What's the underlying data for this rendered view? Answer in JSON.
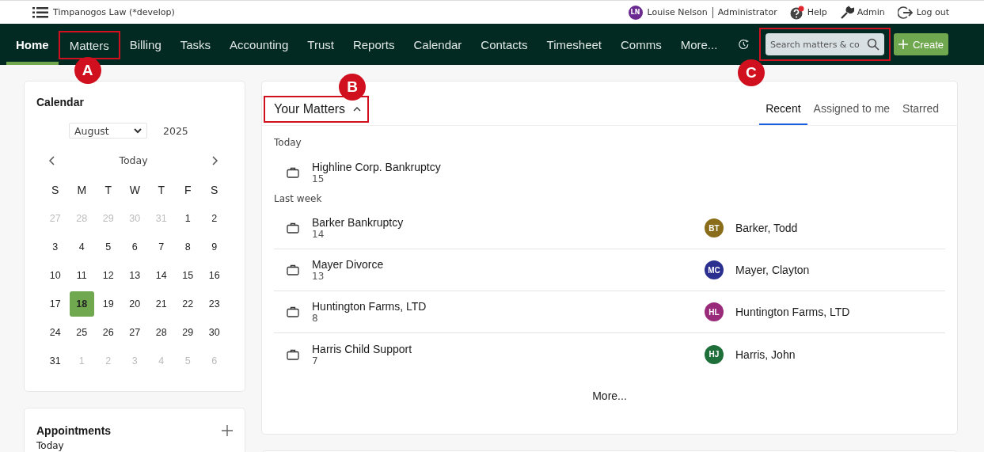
{
  "topbar": {
    "app_title": "Timpanogos Law (*develop)",
    "user": {
      "initials": "LN",
      "name": "Louise Nelson",
      "role": "Administrator",
      "color": "#6b2a8f"
    },
    "links": [
      {
        "kind": "help",
        "label": "Help",
        "notification": true
      },
      {
        "kind": "admin",
        "label": "Admin"
      },
      {
        "kind": "logout",
        "label": "Log out"
      }
    ]
  },
  "nav": {
    "items": [
      {
        "label": "Home",
        "selected": true
      },
      {
        "label": "Matters",
        "selected": false,
        "callout": "A"
      },
      {
        "label": "Billing",
        "selected": false
      },
      {
        "label": "Tasks",
        "selected": false
      },
      {
        "label": "Accounting",
        "selected": false
      },
      {
        "label": "Trust",
        "selected": false
      },
      {
        "label": "Reports",
        "selected": false
      },
      {
        "label": "Calendar",
        "selected": false
      },
      {
        "label": "Contacts",
        "selected": false
      },
      {
        "label": "Timesheet",
        "selected": false
      },
      {
        "label": "Comms",
        "selected": false
      },
      {
        "label": "More...",
        "selected": false
      }
    ],
    "search": {
      "placeholder": "Search matters & co",
      "callout": "C"
    },
    "create_button": "Create"
  },
  "calendar": {
    "title": "Calendar",
    "month": "August",
    "year": "2025",
    "today_label": "Today",
    "weekdays": [
      "S",
      "M",
      "T",
      "W",
      "T",
      "F",
      "S"
    ],
    "days": [
      {
        "label": "27",
        "in_month": false,
        "selected": false
      },
      {
        "label": "28",
        "in_month": false,
        "selected": false
      },
      {
        "label": "29",
        "in_month": false,
        "selected": false
      },
      {
        "label": "30",
        "in_month": false,
        "selected": false
      },
      {
        "label": "31",
        "in_month": false,
        "selected": false
      },
      {
        "label": "1",
        "in_month": true,
        "selected": false
      },
      {
        "label": "2",
        "in_month": true,
        "selected": false
      },
      {
        "label": "3",
        "in_month": true,
        "selected": false
      },
      {
        "label": "4",
        "in_month": true,
        "selected": false
      },
      {
        "label": "5",
        "in_month": true,
        "selected": false
      },
      {
        "label": "6",
        "in_month": true,
        "selected": false
      },
      {
        "label": "7",
        "in_month": true,
        "selected": false
      },
      {
        "label": "8",
        "in_month": true,
        "selected": false
      },
      {
        "label": "9",
        "in_month": true,
        "selected": false
      },
      {
        "label": "10",
        "in_month": true,
        "selected": false
      },
      {
        "label": "11",
        "in_month": true,
        "selected": false
      },
      {
        "label": "12",
        "in_month": true,
        "selected": false
      },
      {
        "label": "13",
        "in_month": true,
        "selected": false
      },
      {
        "label": "14",
        "in_month": true,
        "selected": false
      },
      {
        "label": "15",
        "in_month": true,
        "selected": false
      },
      {
        "label": "16",
        "in_month": true,
        "selected": false
      },
      {
        "label": "17",
        "in_month": true,
        "selected": false
      },
      {
        "label": "18",
        "in_month": true,
        "selected": true
      },
      {
        "label": "19",
        "in_month": true,
        "selected": false
      },
      {
        "label": "20",
        "in_month": true,
        "selected": false
      },
      {
        "label": "21",
        "in_month": true,
        "selected": false
      },
      {
        "label": "22",
        "in_month": true,
        "selected": false
      },
      {
        "label": "23",
        "in_month": true,
        "selected": false
      },
      {
        "label": "24",
        "in_month": true,
        "selected": false
      },
      {
        "label": "25",
        "in_month": true,
        "selected": false
      },
      {
        "label": "26",
        "in_month": true,
        "selected": false
      },
      {
        "label": "27",
        "in_month": true,
        "selected": false
      },
      {
        "label": "28",
        "in_month": true,
        "selected": false
      },
      {
        "label": "29",
        "in_month": true,
        "selected": false
      },
      {
        "label": "30",
        "in_month": true,
        "selected": false
      },
      {
        "label": "31",
        "in_month": true,
        "selected": false
      },
      {
        "label": "1",
        "in_month": false,
        "selected": false
      },
      {
        "label": "2",
        "in_month": false,
        "selected": false
      },
      {
        "label": "3",
        "in_month": false,
        "selected": false
      },
      {
        "label": "4",
        "in_month": false,
        "selected": false
      },
      {
        "label": "5",
        "in_month": false,
        "selected": false
      },
      {
        "label": "6",
        "in_month": false,
        "selected": false
      }
    ]
  },
  "appointments": {
    "title": "Appointments",
    "subtitle": "Today"
  },
  "matters": {
    "title": "Your Matters",
    "callout": "B",
    "tabs": [
      {
        "label": "Recent",
        "selected": true
      },
      {
        "label": "Assigned to me",
        "selected": false
      },
      {
        "label": "Starred",
        "selected": false
      }
    ],
    "groups": [
      {
        "label": "Today",
        "rows": [
          {
            "name": "Highline Corp. Bankruptcy",
            "number": "15"
          }
        ]
      },
      {
        "label": "Last week",
        "rows": [
          {
            "name": "Barker Bankruptcy",
            "number": "14",
            "contact": {
              "initials": "BT",
              "name": "Barker, Todd",
              "color": "#8a6d1a"
            }
          },
          {
            "name": "Mayer Divorce",
            "number": "13",
            "contact": {
              "initials": "MC",
              "name": "Mayer, Clayton",
              "color": "#2b2f8f"
            }
          },
          {
            "name": "Huntington Farms, LTD",
            "number": "8",
            "contact": {
              "initials": "HL",
              "name": "Huntington Farms, LTD",
              "color": "#9a2a7a"
            }
          },
          {
            "name": "Harris Child Support",
            "number": "7",
            "contact": {
              "initials": "HJ",
              "name": "Harris, John",
              "color": "#1f6f3a"
            }
          }
        ]
      }
    ],
    "more_link": "More..."
  }
}
